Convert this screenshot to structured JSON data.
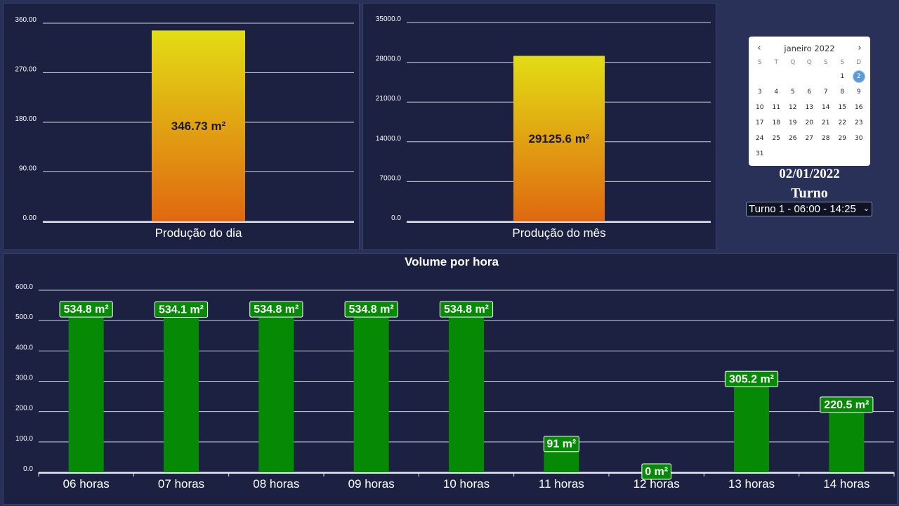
{
  "chart_data": [
    {
      "type": "bar",
      "categories": [
        "Produção do dia"
      ],
      "values": [
        346.73
      ],
      "value_labels": [
        "346.73 m²"
      ],
      "yticks": [
        "0.00",
        "90.00",
        "180.00",
        "270.00",
        "360.00"
      ],
      "ylim": [
        0,
        360
      ],
      "grid": true,
      "colors": {
        "top": "#e2dd14",
        "bottom": "#e06810"
      }
    },
    {
      "type": "bar",
      "categories": [
        "Produção do mês"
      ],
      "values": [
        29125.6
      ],
      "value_labels": [
        "29125.6 m²"
      ],
      "yticks": [
        "0.0",
        "7000.0",
        "14000.0",
        "21000.0",
        "28000.0",
        "35000.0"
      ],
      "ylim": [
        0,
        35000
      ],
      "grid": true,
      "colors": {
        "top": "#e2dd14",
        "bottom": "#e06810"
      }
    },
    {
      "type": "bar",
      "title": "Volume por hora",
      "categories": [
        "06 horas",
        "07 horas",
        "08 horas",
        "09 horas",
        "10 horas",
        "11 horas",
        "12 horas",
        "13 horas",
        "14 horas"
      ],
      "values": [
        534.8,
        534.1,
        534.8,
        534.8,
        534.8,
        91,
        0,
        305.2,
        220.5
      ],
      "value_labels": [
        "534.8 m²",
        "534.1 m²",
        "534.8 m²",
        "534.8 m²",
        "534.8 m²",
        "91 m²",
        "0 m²",
        "305.2 m²",
        "220.5 m²"
      ],
      "yticks": [
        "0.0",
        "100.0",
        "200.0",
        "300.0",
        "400.0",
        "500.0",
        "600.0"
      ],
      "ylim": [
        0,
        600
      ],
      "grid": true,
      "colors": {
        "bar": "#068a06",
        "label_bg": "#068a06",
        "label_border": "#ffffff"
      }
    }
  ],
  "calendar": {
    "month_label": "janeiro 2022",
    "prev_icon": "chevron-left-icon",
    "next_icon": "chevron-right-icon",
    "weekdays": [
      "S",
      "T",
      "Q",
      "Q",
      "S",
      "S",
      "D"
    ],
    "weeks": [
      [
        "",
        "",
        "",
        "",
        "",
        "1",
        "2"
      ],
      [
        "3",
        "4",
        "5",
        "6",
        "7",
        "8",
        "9"
      ],
      [
        "10",
        "11",
        "12",
        "13",
        "14",
        "15",
        "16"
      ],
      [
        "17",
        "18",
        "19",
        "20",
        "21",
        "22",
        "23"
      ],
      [
        "24",
        "25",
        "26",
        "27",
        "28",
        "29",
        "30"
      ],
      [
        "31",
        "",
        "",
        "",
        "",
        "",
        ""
      ]
    ],
    "selected_day": "2",
    "selected_color": "#5a9bd5"
  },
  "date_text": "02/01/2022",
  "turno_label": "Turno",
  "turno_select_value": "Turno 1 - 06:00 - 14:25"
}
